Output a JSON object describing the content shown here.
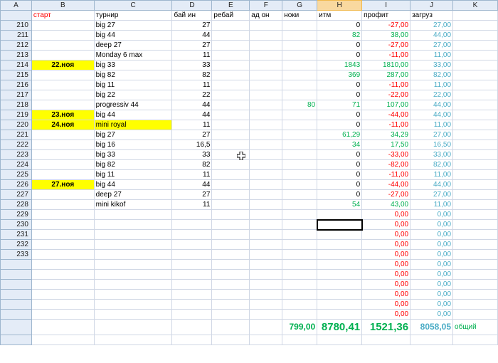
{
  "columns": [
    "A",
    "B",
    "C",
    "D",
    "E",
    "F",
    "G",
    "H",
    "I",
    "J",
    "K"
  ],
  "header_row": {
    "b": "старт",
    "c": "турнир",
    "d": "бай ин",
    "e": "ребай",
    "f": "ад он",
    "g": "ноки",
    "h": "итм",
    "i": "профит",
    "j": "загруз"
  },
  "rows": [
    {
      "n": "210",
      "date": "",
      "name": "big 27",
      "buyin": "27",
      "noki": "",
      "itm": "0",
      "profit": "-27,00",
      "load": "27,00"
    },
    {
      "n": "211",
      "date": "",
      "name": "big 44",
      "buyin": "44",
      "noki": "",
      "itm": "82",
      "profit": "38,00",
      "load": "44,00"
    },
    {
      "n": "212",
      "date": "",
      "name": "deep 27",
      "buyin": "27",
      "noki": "",
      "itm": "0",
      "profit": "-27,00",
      "load": "27,00"
    },
    {
      "n": "213",
      "date": "",
      "name": "Monday 6 max",
      "buyin": "11",
      "noki": "",
      "itm": "0",
      "profit": "-11,00",
      "load": "11,00"
    },
    {
      "n": "214",
      "date": "22.ноя",
      "name": "big 33",
      "buyin": "33",
      "noki": "",
      "itm": "1843",
      "profit": "1810,00",
      "load": "33,00"
    },
    {
      "n": "215",
      "date": "",
      "name": "big 82",
      "buyin": "82",
      "noki": "",
      "itm": "369",
      "profit": "287,00",
      "load": "82,00"
    },
    {
      "n": "216",
      "date": "",
      "name": "big 11",
      "buyin": "11",
      "noki": "",
      "itm": "0",
      "profit": "-11,00",
      "load": "11,00"
    },
    {
      "n": "217",
      "date": "",
      "name": "big 22",
      "buyin": "22",
      "noki": "",
      "itm": "0",
      "profit": "-22,00",
      "load": "22,00"
    },
    {
      "n": "218",
      "date": "",
      "name": "progressiv 44",
      "buyin": "44",
      "noki": "80",
      "itm": "71",
      "profit": "107,00",
      "load": "44,00"
    },
    {
      "n": "219",
      "date": "23.ноя",
      "name": "big 44",
      "buyin": "44",
      "noki": "",
      "itm": "0",
      "profit": "-44,00",
      "load": "44,00"
    },
    {
      "n": "220",
      "date": "24.ноя",
      "name": "mini royal",
      "buyin": "11",
      "noki": "",
      "itm": "0",
      "profit": "-11,00",
      "load": "11,00"
    },
    {
      "n": "221",
      "date": "",
      "name": "big 27",
      "buyin": "27",
      "noki": "",
      "itm": "61,29",
      "profit": "34,29",
      "load": "27,00"
    },
    {
      "n": "222",
      "date": "",
      "name": "big 16",
      "buyin": "16,5",
      "noki": "",
      "itm": "34",
      "profit": "17,50",
      "load": "16,50"
    },
    {
      "n": "223",
      "date": "",
      "name": "big 33",
      "buyin": "33",
      "noki": "",
      "itm": "0",
      "profit": "-33,00",
      "load": "33,00"
    },
    {
      "n": "224",
      "date": "",
      "name": "big 82",
      "buyin": "82",
      "noki": "",
      "itm": "0",
      "profit": "-82,00",
      "load": "82,00"
    },
    {
      "n": "225",
      "date": "",
      "name": "big 11",
      "buyin": "11",
      "noki": "",
      "itm": "0",
      "profit": "-11,00",
      "load": "11,00"
    },
    {
      "n": "226",
      "date": "27.ноя",
      "name": "big 44",
      "buyin": "44",
      "noki": "",
      "itm": "0",
      "profit": "-44,00",
      "load": "44,00"
    },
    {
      "n": "227",
      "date": "",
      "name": "deep 27",
      "buyin": "27",
      "noki": "",
      "itm": "0",
      "profit": "-27,00",
      "load": "27,00"
    },
    {
      "n": "228",
      "date": "",
      "name": "mini kikof",
      "buyin": "11",
      "noki": "",
      "itm": "54",
      "profit": "43,00",
      "load": "11,00"
    },
    {
      "n": "229",
      "date": "",
      "name": "",
      "buyin": "",
      "noki": "",
      "itm": "",
      "profit": "0,00",
      "load": "0,00"
    },
    {
      "n": "230",
      "date": "",
      "name": "",
      "buyin": "",
      "noki": "",
      "itm": "",
      "profit": "0,00",
      "load": "0,00"
    },
    {
      "n": "231",
      "date": "",
      "name": "",
      "buyin": "",
      "noki": "",
      "itm": "",
      "profit": "0,00",
      "load": "0,00"
    },
    {
      "n": "232",
      "date": "",
      "name": "",
      "buyin": "",
      "noki": "",
      "itm": "",
      "profit": "0,00",
      "load": "0,00"
    },
    {
      "n": "233",
      "date": "",
      "name": "",
      "buyin": "",
      "noki": "",
      "itm": "",
      "profit": "0,00",
      "load": "0,00"
    },
    {
      "n": "",
      "date": "",
      "name": "",
      "buyin": "",
      "noki": "",
      "itm": "",
      "profit": "0,00",
      "load": "0,00"
    },
    {
      "n": "",
      "date": "",
      "name": "",
      "buyin": "",
      "noki": "",
      "itm": "",
      "profit": "0,00",
      "load": "0,00"
    },
    {
      "n": "",
      "date": "",
      "name": "",
      "buyin": "",
      "noki": "",
      "itm": "",
      "profit": "0,00",
      "load": "0,00"
    },
    {
      "n": "",
      "date": "",
      "name": "",
      "buyin": "",
      "noki": "",
      "itm": "",
      "profit": "0,00",
      "load": "0,00"
    },
    {
      "n": "",
      "date": "",
      "name": "",
      "buyin": "",
      "noki": "",
      "itm": "",
      "profit": "0,00",
      "load": "0,00"
    },
    {
      "n": "",
      "date": "",
      "name": "",
      "buyin": "",
      "noki": "",
      "itm": "",
      "profit": "0,00",
      "load": "0,00"
    }
  ],
  "totals": {
    "noki": "799,00",
    "itm": "8780,41",
    "profit": "1521,36",
    "load": "8058,05",
    "label": "общий"
  },
  "selected_row": "230",
  "colors": {
    "green": "#00b050",
    "red": "#ff0000",
    "teal": "#4bacc6",
    "yellow": "#ffff00"
  }
}
